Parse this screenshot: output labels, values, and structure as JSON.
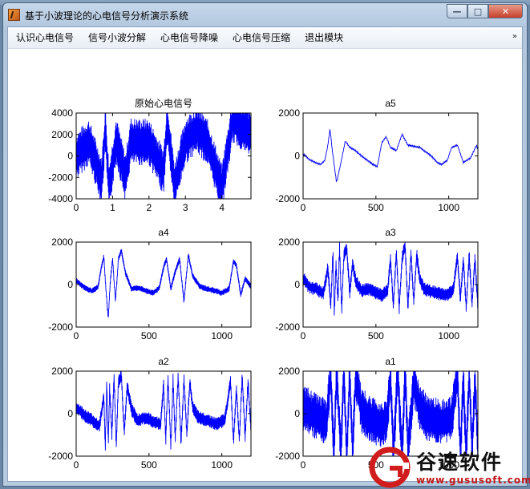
{
  "window": {
    "title": "基于小波理论的心电信号分析演示系统",
    "min": "—",
    "max": "□",
    "close": "✕"
  },
  "menu": {
    "items": [
      "认识心电信号",
      "信号小波分解",
      "心电信号降噪",
      "心电信号压缩",
      "退出模块"
    ],
    "overflow": "»"
  },
  "plot_color": "#0000ff",
  "chart_data": [
    {
      "type": "line",
      "title": "原始心电信号",
      "xlim": [
        0,
        4.8
      ],
      "ylim": [
        -4000,
        4000
      ],
      "xticks": [
        "0",
        "1",
        "2",
        "3",
        "4"
      ],
      "yticks": [
        "4000",
        "2000",
        "0",
        "-2000",
        "-4000"
      ],
      "style": "noisy-dense",
      "x": [
        0,
        0.35,
        0.7,
        0.8,
        0.9,
        1.1,
        1.35,
        1.5,
        1.7,
        2.0,
        2.4,
        2.5,
        2.7,
        3.0,
        3.3,
        3.6,
        4.0,
        4.3,
        4.8
      ],
      "y": [
        0,
        1300,
        -2300,
        2500,
        -3000,
        1500,
        -2000,
        1400,
        1300,
        1300,
        -1500,
        3200,
        -2800,
        1400,
        2500,
        1300,
        -3000,
        3400,
        2000
      ]
    },
    {
      "type": "line",
      "title": "a5",
      "xlim": [
        0,
        1200
      ],
      "ylim": [
        -2000,
        2000
      ],
      "xticks": [
        "0",
        "500",
        "1000"
      ],
      "yticks": [
        "2000",
        "0",
        "-2000"
      ],
      "style": "smooth",
      "x": [
        0,
        40,
        80,
        120,
        150,
        170,
        185,
        200,
        215,
        230,
        260,
        290,
        320,
        360,
        400,
        440,
        480,
        510,
        540,
        570,
        600,
        640,
        680,
        720,
        760,
        800,
        840,
        880,
        920,
        950,
        990,
        1020,
        1060,
        1100,
        1150,
        1190,
        1200
      ],
      "y": [
        100,
        -150,
        -300,
        -400,
        -200,
        500,
        1250,
        300,
        -500,
        -1250,
        -300,
        700,
        400,
        250,
        0,
        -200,
        -400,
        -500,
        600,
        900,
        400,
        250,
        1000,
        500,
        450,
        400,
        200,
        0,
        -300,
        -400,
        -200,
        400,
        500,
        -300,
        -100,
        500,
        300
      ]
    },
    {
      "type": "line",
      "title": "a4",
      "xlim": [
        0,
        1200
      ],
      "ylim": [
        -2000,
        2000
      ],
      "xticks": [
        "0",
        "500",
        "1000"
      ],
      "yticks": [
        "2000",
        "0",
        "-2000"
      ],
      "style": "medium",
      "x": [
        0,
        30,
        70,
        110,
        150,
        175,
        190,
        205,
        220,
        235,
        250,
        270,
        290,
        310,
        340,
        380,
        430,
        480,
        530,
        570,
        600,
        620,
        650,
        680,
        710,
        740,
        770,
        800,
        850,
        900,
        960,
        1000,
        1050,
        1080,
        1100,
        1130,
        1160,
        1200
      ],
      "y": [
        200,
        0,
        -200,
        -300,
        -100,
        900,
        1300,
        -300,
        -1600,
        200,
        1200,
        -800,
        1200,
        1600,
        500,
        -200,
        -150,
        -300,
        -400,
        -150,
        800,
        1200,
        -200,
        600,
        1200,
        -800,
        1400,
        400,
        -100,
        -200,
        -300,
        -400,
        -200,
        1100,
        900,
        -500,
        300,
        -100
      ]
    },
    {
      "type": "line",
      "title": "a3",
      "xlim": [
        0,
        1200
      ],
      "ylim": [
        -2000,
        2000
      ],
      "xticks": [
        "0",
        "500",
        "1000"
      ],
      "yticks": [
        "2000",
        "0",
        "-2000"
      ],
      "style": "noisy",
      "x": [
        0,
        40,
        90,
        140,
        170,
        190,
        205,
        215,
        225,
        240,
        250,
        265,
        280,
        300,
        320,
        340,
        360,
        400,
        450,
        500,
        540,
        580,
        600,
        620,
        640,
        660,
        680,
        700,
        720,
        740,
        760,
        780,
        800,
        830,
        870,
        920,
        980,
        1030,
        1060,
        1080,
        1100,
        1120,
        1140,
        1160,
        1180,
        1200
      ],
      "y": [
        300,
        -100,
        -200,
        -400,
        800,
        -1000,
        1500,
        -1500,
        1000,
        -800,
        1800,
        -1200,
        1400,
        1700,
        -400,
        1000,
        200,
        -300,
        -200,
        -400,
        -500,
        -300,
        1200,
        -1000,
        1500,
        -1100,
        1200,
        1900,
        -1100,
        1500,
        -800,
        1400,
        300,
        -200,
        -300,
        -400,
        -500,
        -300,
        1300,
        -700,
        1200,
        -1100,
        1400,
        -900,
        1200,
        -1000
      ]
    },
    {
      "type": "line",
      "title": "a2",
      "xlim": [
        0,
        1200
      ],
      "ylim": [
        -2000,
        2000
      ],
      "xticks": [
        "0",
        "500",
        "1000"
      ],
      "yticks": [
        "2000",
        "0",
        "-2000"
      ],
      "style": "noisy",
      "x": [
        0,
        60,
        110,
        160,
        190,
        200,
        210,
        220,
        230,
        245,
        260,
        275,
        290,
        310,
        330,
        350,
        380,
        420,
        480,
        540,
        580,
        600,
        615,
        630,
        650,
        665,
        680,
        700,
        720,
        740,
        760,
        780,
        800,
        840,
        900,
        960,
        1020,
        1060,
        1080,
        1100,
        1120,
        1140,
        1160,
        1180,
        1200
      ],
      "y": [
        300,
        -100,
        -300,
        -600,
        800,
        -1700,
        1600,
        -1400,
        1200,
        -1000,
        1800,
        -1500,
        1500,
        1800,
        -900,
        1300,
        200,
        -300,
        -200,
        -400,
        -500,
        1400,
        -1300,
        1700,
        -1500,
        1600,
        -1200,
        1800,
        -1400,
        1600,
        -1000,
        1500,
        300,
        -200,
        -300,
        -500,
        -300,
        1500,
        -1300,
        1200,
        -1200,
        1800,
        -1100,
        1500,
        -700
      ]
    },
    {
      "type": "line",
      "title": "a1",
      "xlim": [
        0,
        1200
      ],
      "ylim": [
        -2000,
        2000
      ],
      "xticks": [
        "0",
        "500",
        "1000"
      ],
      "yticks": [
        "2000",
        "0",
        "-2000"
      ],
      "style": "noisy-dense",
      "x": [
        0,
        60,
        120,
        160,
        190,
        210,
        230,
        260,
        280,
        300,
        320,
        340,
        360,
        400,
        450,
        500,
        540,
        580,
        600,
        620,
        650,
        680,
        700,
        720,
        760,
        800,
        850,
        900,
        960,
        1020,
        1060,
        1080,
        1100,
        1120,
        1140,
        1160,
        1180,
        1200
      ],
      "y": [
        300,
        0,
        -200,
        -500,
        2000,
        -2000,
        1900,
        -1800,
        2000,
        -2000,
        2000,
        -1900,
        1800,
        200,
        -200,
        -400,
        -500,
        -200,
        2000,
        -1800,
        2000,
        -2000,
        2000,
        -1700,
        1500,
        300,
        -200,
        -300,
        -400,
        -300,
        1800,
        -1900,
        1600,
        -2000,
        2000,
        -1800,
        1700,
        -1500
      ]
    }
  ],
  "watermark": {
    "title": "谷速软件",
    "url": "www.gususoft.com"
  }
}
